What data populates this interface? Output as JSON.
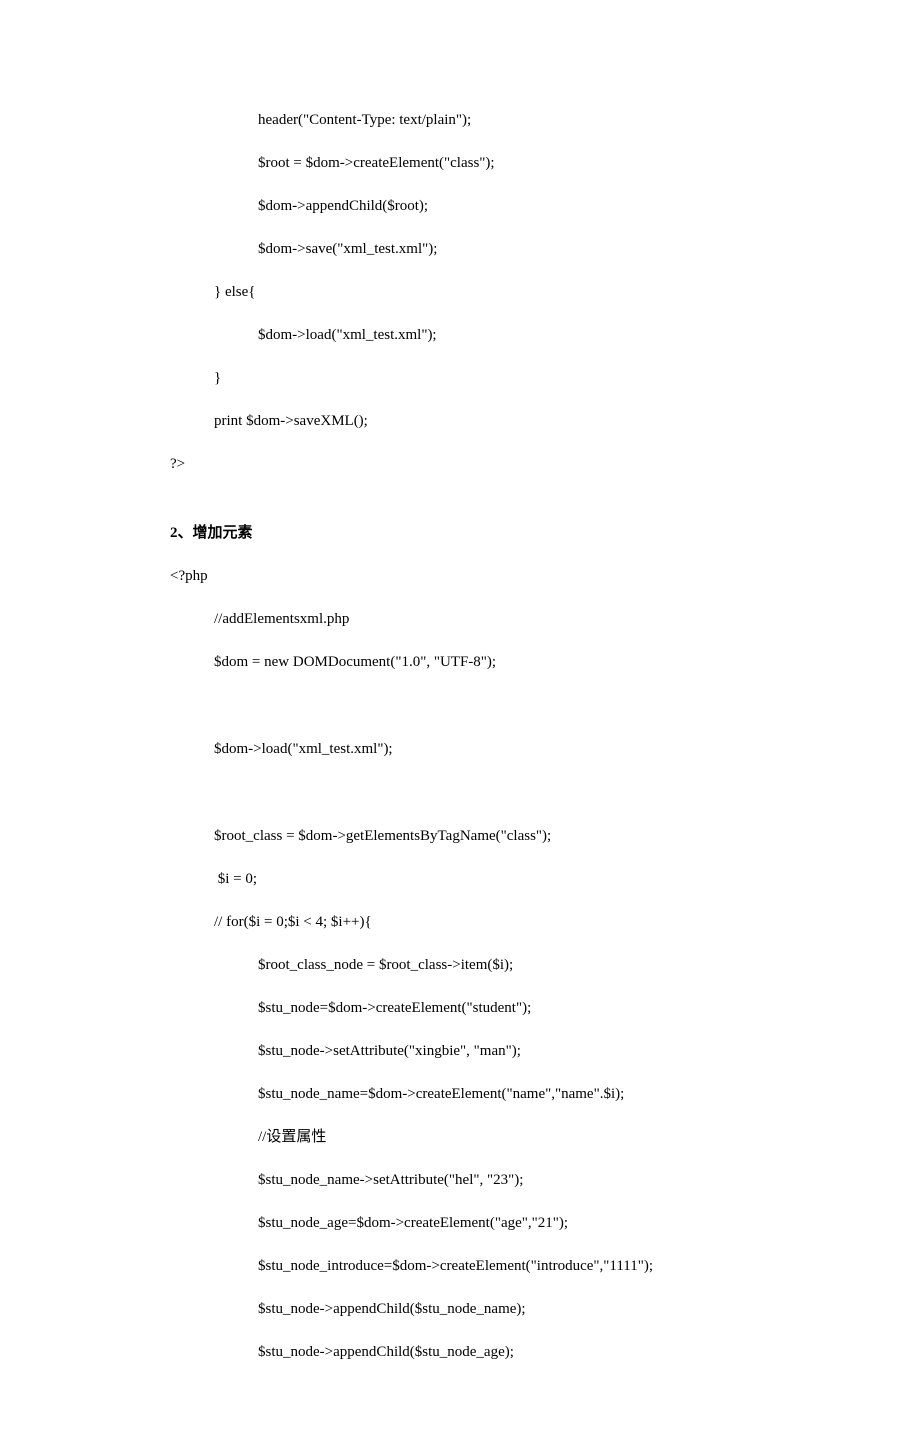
{
  "block1": {
    "l1": "header(\"Content-Type: text/plain\");",
    "l2": "$root = $dom->createElement(\"class\");",
    "l3": "$dom->appendChild($root);",
    "l4": "$dom->save(\"xml_test.xml\");",
    "l5": "} else{",
    "l6": "$dom->load(\"xml_test.xml\");",
    "l7": "}",
    "l8": "print $dom->saveXML();",
    "l9": "?>"
  },
  "heading": "2、增加元素",
  "block2": {
    "l1": "<?php",
    "l2": "//addElementsxml.php",
    "l3": "$dom = new DOMDocument(\"1.0\", \"UTF-8\");",
    "l4": "$dom->load(\"xml_test.xml\");",
    "l5": "$root_class = $dom->getElementsByTagName(\"class\");",
    "l6": " $i = 0;",
    "l7": "// for($i = 0;$i < 4; $i++){",
    "l8": "$root_class_node = $root_class->item($i);",
    "l9": "$stu_node=$dom->createElement(\"student\");",
    "l10": "$stu_node->setAttribute(\"xingbie\", \"man\");",
    "l11": "$stu_node_name=$dom->createElement(\"name\",\"name\".$i);",
    "l12": "//设置属性",
    "l13": "$stu_node_name->setAttribute(\"hel\", \"23\");",
    "l14": "$stu_node_age=$dom->createElement(\"age\",\"21\");",
    "l15": "$stu_node_introduce=$dom->createElement(\"introduce\",\"1111\");",
    "l16": "$stu_node->appendChild($stu_node_name);",
    "l17": "$stu_node->appendChild($stu_node_age);"
  }
}
